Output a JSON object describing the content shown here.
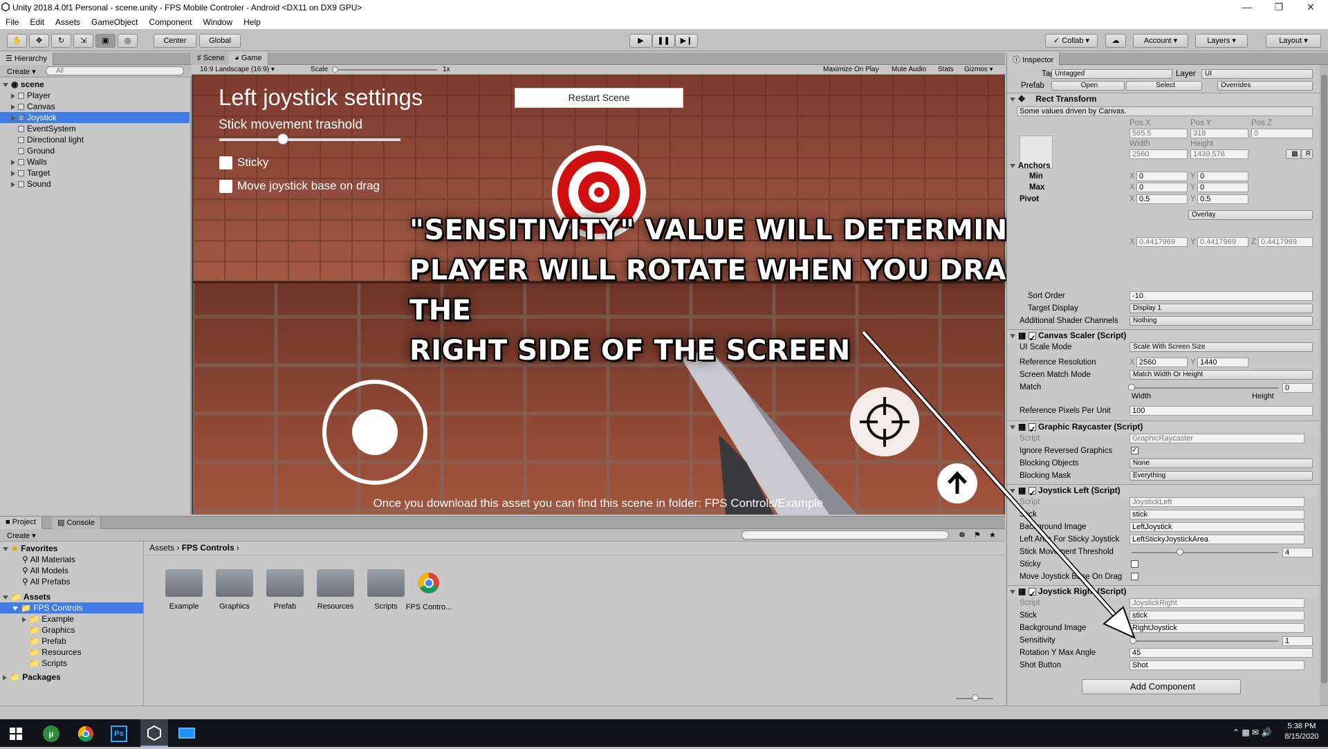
{
  "window": {
    "title": "Unity 2018.4.0f1 Personal - scene.unity - FPS Mobile Controler - Android <DX11 on DX9 GPU>"
  },
  "menu": [
    "File",
    "Edit",
    "Assets",
    "GameObject",
    "Component",
    "Window",
    "Help"
  ],
  "toolbar": {
    "center": "Center",
    "global": "Global",
    "collab": "Collab",
    "account": "Account",
    "layers": "Layers",
    "layout": "Layout"
  },
  "hierarchy": {
    "tab": "Hierarchy",
    "create": "Create",
    "search_placeholder": "All",
    "scene": "scene",
    "items": [
      "Player",
      "Canvas",
      "Joystick",
      "EventSystem",
      "Directional light",
      "Ground",
      "Walls",
      "Target",
      "Sound"
    ]
  },
  "game_tabs": {
    "scene": "Scene",
    "game": "Game"
  },
  "game_bar": {
    "aspect": "16:9 Landscape (16:9)",
    "scale_label": "Scale",
    "scale_value": "1x",
    "maximize": "Maximize On Play",
    "mute": "Mute Audio",
    "stats": "Stats",
    "gizmos": "Gizmos"
  },
  "game": {
    "heading": "Left joystick settings",
    "slider_label": "Stick movement trashold",
    "slider_value": 0.35,
    "opt_sticky": "Sticky",
    "opt_move_base": "Move joystick base on drag",
    "restart": "Restart Scene",
    "footer": "Once you download this asset you can find this scene in folder: FPS Controls/Example"
  },
  "overlay_text": [
    "\"Sensitivity\" value will determine how fast",
    "player will rotate when you drag finger on the",
    "right side of the screen"
  ],
  "project": {
    "tabs": [
      "Project",
      "Console"
    ],
    "create": "Create",
    "favorites": "Favorites",
    "fav_items": [
      "All Materials",
      "All Models",
      "All Prefabs"
    ],
    "assets": "Assets",
    "tree": [
      "FPS Controls",
      "Example",
      "Graphics",
      "Prefab",
      "Resources",
      "Scripts"
    ],
    "packages": "Packages",
    "breadcrumb": [
      "Assets",
      "FPS Controls"
    ],
    "files": [
      "Example",
      "Graphics",
      "Prefab",
      "Resources",
      "Scripts",
      "FPS Contro..."
    ]
  },
  "inspector": {
    "tab": "Inspector",
    "tag_label": "Tag",
    "tag_value": "Untagged",
    "layer_label": "Layer",
    "layer_value": "UI",
    "prefab_label": "Prefab",
    "prefab_open": "Open",
    "prefab_select": "Select",
    "prefab_overrides": "Overrides",
    "rect_transform": "Rect Transform",
    "driven_note": "Some values driven by Canvas.",
    "pos_x_label": "Pos X",
    "pos_y_label": "Pos Y",
    "pos_z_label": "Pos Z",
    "pos_x": "565.5",
    "pos_y": "318",
    "pos_z": "0",
    "width_label": "Width",
    "height_label": "Height",
    "width": "2560",
    "height": "1439.576",
    "anchors": "Anchors",
    "min": "Min",
    "max": "Max",
    "pivot": "Pivot",
    "zero": "0",
    "half": "0.5",
    "scale_val": "0.4417969",
    "x": "X",
    "y": "Y",
    "z": "Z",
    "r": "R",
    "overlay_mode": "Overlay",
    "sort_order_label": "Sort Order",
    "sort_order": "-10",
    "target_display_label": "Target Display",
    "target_display": "Display 1",
    "shader_channels_label": "Additional Shader Channels",
    "shader_channels": "Nothing",
    "canvas_scaler": "Canvas Scaler (Script)",
    "ui_scale_mode_label": "UI Scale Mode",
    "ui_scale_mode": "Scale With Screen Size",
    "ref_res_label": "Reference Resolution",
    "ref_res_x": "2560",
    "ref_res_y": "1440",
    "screen_match_label": "Screen Match Mode",
    "screen_match": "Match Width Or Height",
    "match_label": "Match",
    "match_value": "0",
    "match_width": "Width",
    "match_height": "Height",
    "ref_ppu_label": "Reference Pixels Per Unit",
    "ref_ppu": "100",
    "graphic_raycaster": "Graphic Raycaster (Script)",
    "script_label": "Script",
    "raycaster_script": "GraphicRaycaster",
    "ignore_reversed_label": "Ignore Reversed Graphics",
    "blocking_objects_label": "Blocking Objects",
    "blocking_objects": "None",
    "blocking_mask_label": "Blocking Mask",
    "blocking_mask": "Everything",
    "joystick_left": "Joystick Left (Script)",
    "jl_script": "JoystickLeft",
    "stick_label": "Stick",
    "stick": "stick",
    "bg_image_label": "Background Image",
    "jl_bg": "LeftJoystick",
    "left_area_label": "Left Area For Sticky Joystick",
    "left_area": "LeftStickyJoystickArea",
    "threshold_label": "Stick Movement Threshold",
    "threshold": "4",
    "sticky_label": "Sticky",
    "move_base_label": "Move Joystick Base On Drag",
    "joystick_right": "Joystick Right (Script)",
    "jr_script": "JoystickRight",
    "jr_bg": "RightJoystick",
    "sensitivity_label": "Sensitivity",
    "sensitivity": "1",
    "rot_max_label": "Rotation Y Max Angle",
    "rot_max": "45",
    "shot_button_label": "Shot Button",
    "shot_button": "Shot",
    "add_component": "Add Component"
  },
  "taskbar": {
    "time": "5:38 PM",
    "date": "8/15/2020"
  }
}
